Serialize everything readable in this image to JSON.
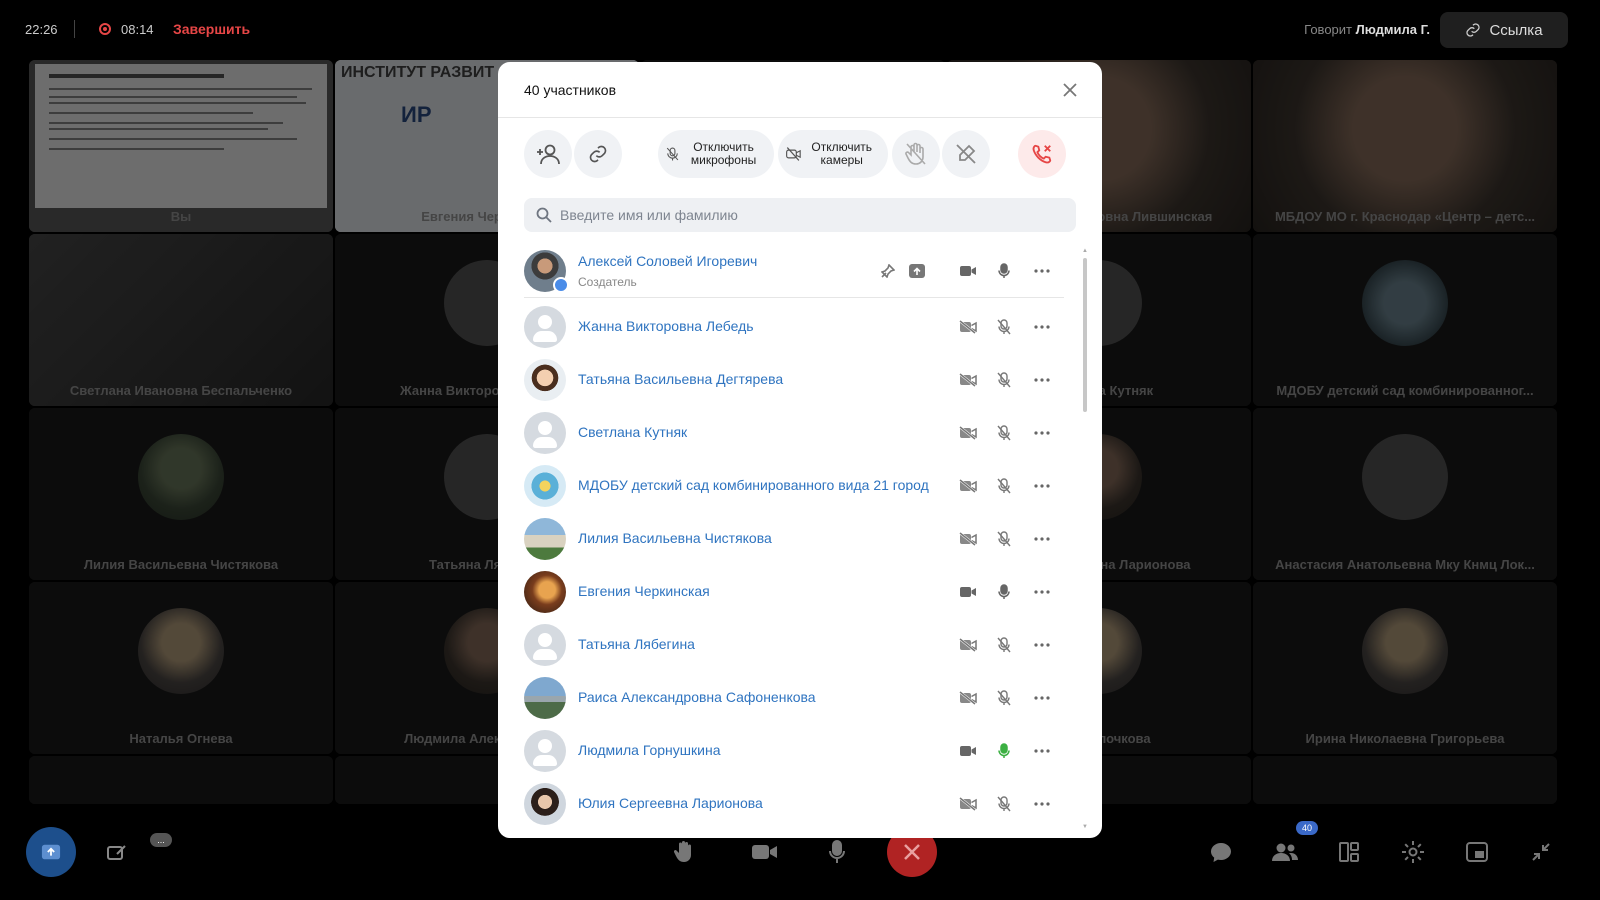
{
  "topbar": {
    "time": "22:26",
    "rec_time": "08:14",
    "end_label": "Завершить",
    "speaking_prefix": "Говорит",
    "speaking_name": "Людмила Г.",
    "link_label": "Ссылка"
  },
  "tiles": [
    {
      "name": "Вы"
    },
    {
      "name": "Евгения Черкинская"
    },
    {
      "name": ""
    },
    {
      "name": "Раиса Александровна Лившинская"
    },
    {
      "name": "МБДОУ МО г. Краснодар «Центр – детс..."
    },
    {
      "name": "Светлана Ивановна Беспальченко"
    },
    {
      "name": "Жанна Викторовна Лебедь"
    },
    {
      "name": ""
    },
    {
      "name": "Светлана Кутняк"
    },
    {
      "name": "МДОБУ детский сад комбинированног..."
    },
    {
      "name": "Лилия Васильевна Чистякова"
    },
    {
      "name": "Татьяна Лябегина"
    },
    {
      "name": ""
    },
    {
      "name": "Юлия Сергеевна Ларионова"
    },
    {
      "name": "Анастасия Анатольевна Мку Кнмц Лок..."
    },
    {
      "name": "Наталья Огнева"
    },
    {
      "name": "Людмила Александровна"
    },
    {
      "name": ""
    },
    {
      "name": "Елена Клочкова"
    },
    {
      "name": "Ирина Николаевна Григорьева"
    }
  ],
  "slide": {
    "header_text": "ИНСТИТУТ РАЗВИТ",
    "logo_text": "ИР"
  },
  "bottombar": {
    "participants_count": "40",
    "grey_badge": "..."
  },
  "modal": {
    "title": "40 участников",
    "actions": {
      "mute_mics": "Отключить микрофоны",
      "disable_cams": "Отключить камеры"
    },
    "search_placeholder": "Введите имя или фамилию",
    "participants": [
      {
        "name": "Алексей Соловей Игоревич",
        "role": "Создатель",
        "cam": "on",
        "mic": "on",
        "avatar": "pic-man"
      },
      {
        "name": "Жанна Викторовна Лебедь",
        "cam": "off",
        "mic": "off",
        "avatar": "default"
      },
      {
        "name": "Татьяна Васильевна Дегтярева",
        "cam": "off",
        "mic": "off",
        "avatar": "pic-cartoon"
      },
      {
        "name": "Светлана Кутняк",
        "cam": "off",
        "mic": "off",
        "avatar": "default"
      },
      {
        "name": "МДОБУ детский сад комбинированного вида 21 город",
        "cam": "off",
        "mic": "off",
        "avatar": "pic-logo"
      },
      {
        "name": "Лилия Васильевна Чистякова",
        "cam": "off",
        "mic": "off",
        "avatar": "pic-building"
      },
      {
        "name": "Евгения Черкинская",
        "cam": "on",
        "mic": "on",
        "avatar": "pic-sunset"
      },
      {
        "name": "Татьяна Лябегина",
        "cam": "off",
        "mic": "off",
        "avatar": "default"
      },
      {
        "name": "Раиса Александровна Сафоненкова",
        "cam": "off",
        "mic": "off",
        "avatar": "pic-mountain"
      },
      {
        "name": "Людмила Горнушкина",
        "cam": "on",
        "mic": "speaking",
        "avatar": "default"
      },
      {
        "name": "Юлия Сергеевна Ларионова",
        "cam": "off",
        "mic": "off",
        "avatar": "pic-woman"
      }
    ]
  },
  "colors": {
    "accent": "#2f74c0",
    "danger": "#e64646",
    "speaking": "#3cb043"
  }
}
